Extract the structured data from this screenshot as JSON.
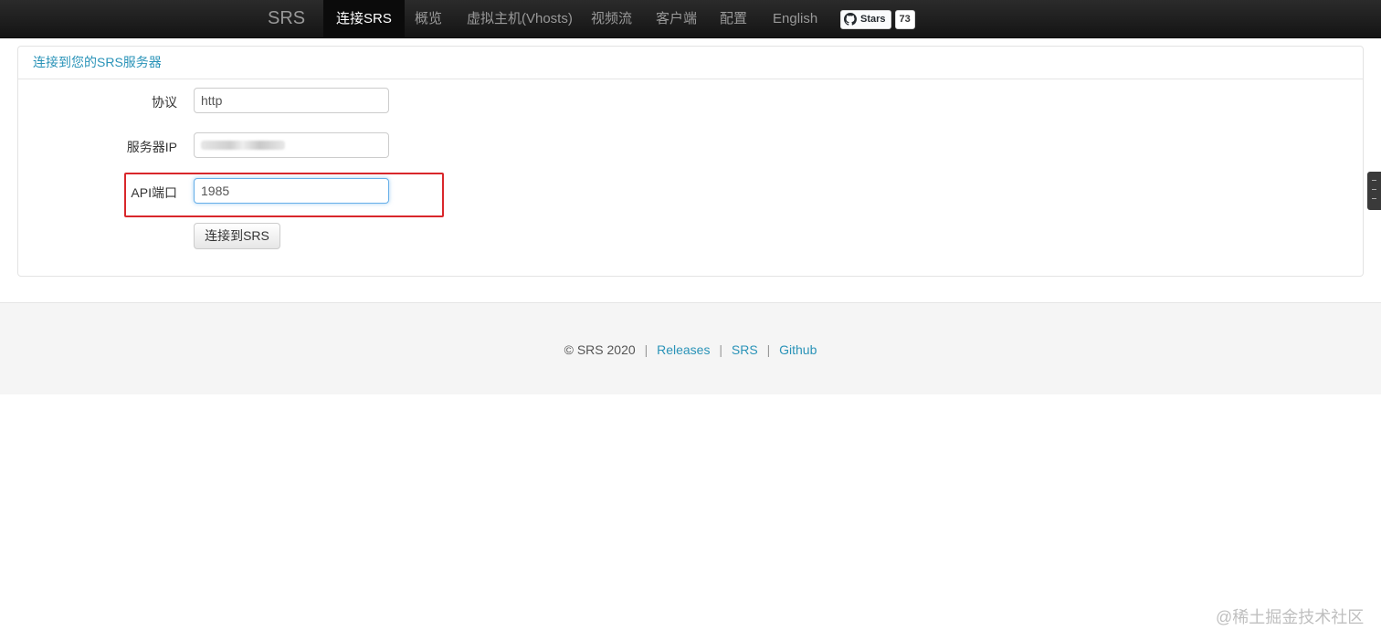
{
  "navbar": {
    "brand": "SRS",
    "items": [
      {
        "label": "连接SRS",
        "active": true
      },
      {
        "label": "概览",
        "active": false
      },
      {
        "label": "虚拟主机(Vhosts)",
        "active": false
      },
      {
        "label": "视频流",
        "active": false
      },
      {
        "label": "客户端",
        "active": false
      },
      {
        "label": "配置",
        "active": false
      },
      {
        "label": "English",
        "active": false
      }
    ],
    "github_button": {
      "label": "Stars",
      "count": "73",
      "icon": "github-icon"
    }
  },
  "panel": {
    "heading": "连接到您的SRS服务器",
    "fields": [
      {
        "label": "协议",
        "value": "http"
      },
      {
        "label": "服务器IP",
        "value": ""
      },
      {
        "label": "API端口",
        "value": "1985"
      }
    ],
    "connect_button": "连接到SRS"
  },
  "footer": {
    "copyright": "© SRS 2020",
    "links": [
      "Releases",
      "SRS",
      "Github"
    ],
    "separator": "|"
  },
  "watermark": "@稀土掘金技术社区",
  "colors": {
    "accent": "#2a93b8",
    "navbar": "#1b1b1b",
    "highlight": "#d9272b"
  }
}
